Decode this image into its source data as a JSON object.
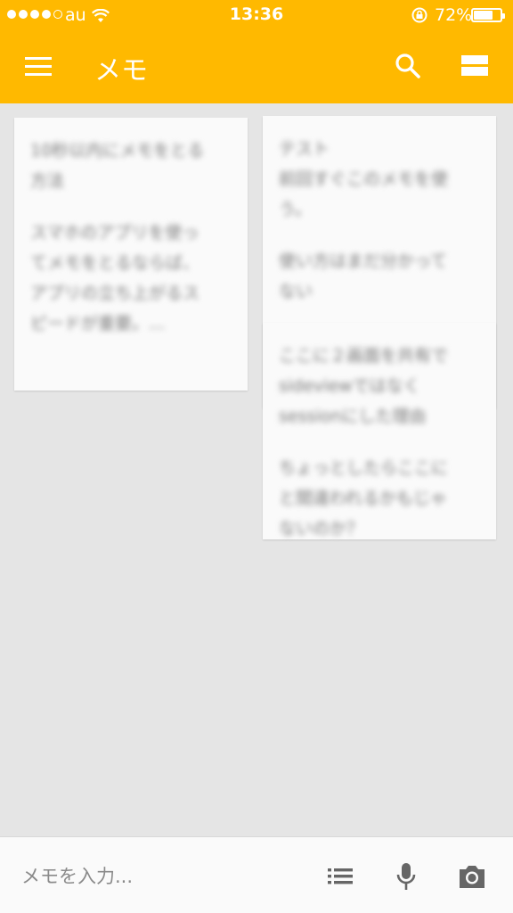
{
  "status_bar": {
    "carrier": "au",
    "time": "13:36",
    "battery_percent_text": "72%",
    "battery_level": 0.72
  },
  "app_bar": {
    "title": "メモ",
    "background_color": "#ffb900",
    "icons": [
      "menu-icon",
      "search-icon",
      "layout-icon"
    ]
  },
  "notes": [
    {
      "paragraphs": [
        "10秒以内にメモをとる\n方法",
        "スマホのアプリを使っ\nてメモをとるならば、\nアプリの立ち上がるス\nピードが重要。..."
      ]
    },
    {
      "paragraphs": [
        "テスト\n前回すぐこのメモを使う。",
        "使い方はまだ分かって\nない"
      ]
    },
    {
      "paragraphs": [
        "ここに２画面を共有で\nsideviewではなく\nsessionにした理由",
        "ちょっとしたらここに\nと間違われるかもじゃ\nないのか？"
      ]
    }
  ],
  "bottom_bar": {
    "placeholder": "メモを入力...",
    "icons": [
      "list-icon",
      "microphone-icon",
      "camera-icon"
    ]
  }
}
